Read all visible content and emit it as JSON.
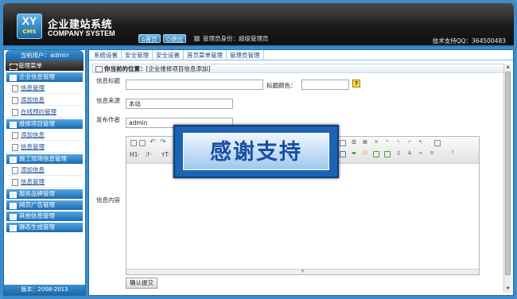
{
  "header": {
    "logo_main": "XY",
    "logo_sub": "CMS",
    "title_cn": "企业建站系统",
    "title_en": "COMPANY SYSTEM",
    "home_label": "首页",
    "logout_label": "退出",
    "admin_identity": "管理员身份：超级管理员",
    "support": "技术支持QQ：364500483"
  },
  "sidebar": {
    "current_user": "当前用户：admin",
    "menu_title": "管理菜单",
    "groups": [
      {
        "label": "企业信息管理",
        "items": [
          "信息管理",
          "添加信息",
          "在线预约管理"
        ]
      },
      {
        "label": "维修项目管理",
        "items": [
          "添加信息",
          "信息管理"
        ]
      },
      {
        "label": "施工现场信息管理",
        "items": [
          "添加信息",
          "信息管理"
        ]
      },
      {
        "label": "服务品牌管理",
        "items": []
      },
      {
        "label": "网页广告管理",
        "items": []
      },
      {
        "label": "其他信息管理",
        "items": []
      },
      {
        "label": "静态生成管理",
        "items": []
      }
    ],
    "version": "版本：2008-2013"
  },
  "tabs": [
    "系统设置",
    "安全管理",
    "安全设置",
    "首页菜单管理",
    "管理员管理"
  ],
  "breadcrumb": {
    "prefix": "你当前的位置：",
    "path": "[企业维修项目信息添加]"
  },
  "form": {
    "title_label": "信息标题",
    "title_value": "",
    "color_label": "标题颜色：",
    "color_value": "",
    "help_glyph": "?",
    "source_label": "信息来源",
    "source_value": "本站",
    "author_label": "发布作者",
    "author_value": "admin",
    "content_label": "信息内容",
    "submit_label": "确认提交"
  },
  "editor": {
    "heading_label": "H1·",
    "font_label": "ℱ·",
    "size_label": "тT·",
    "resize_glyph": "⁜"
  },
  "overlay": {
    "text": "感谢支持"
  }
}
